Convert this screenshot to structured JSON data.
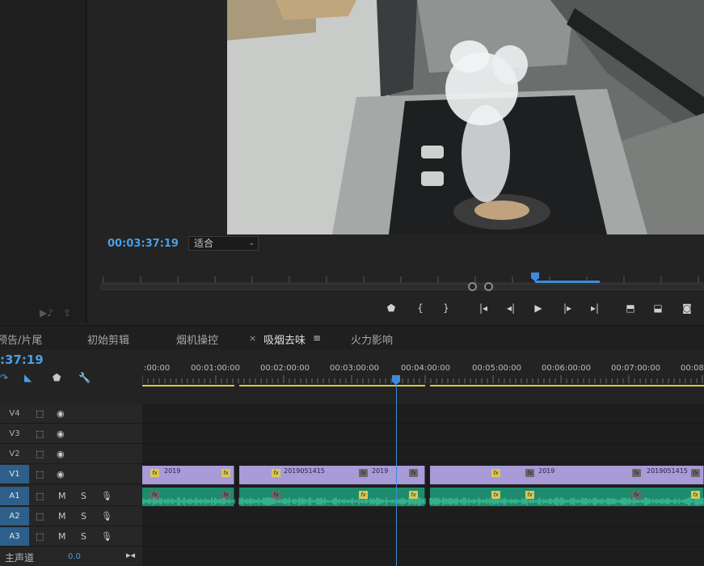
{
  "monitor": {
    "timecode": "00:03:37:19",
    "fit_label": "适合"
  },
  "tabs": [
    {
      "label": "预告/片尾"
    },
    {
      "label": "初始剪辑"
    },
    {
      "label": "烟机操控"
    },
    {
      "label": "吸烟去味",
      "active": true
    },
    {
      "label": "火力影响"
    }
  ],
  "tab_close": "×",
  "tab_menu": "≡",
  "sequence": {
    "timecode": ":37:19",
    "ruler_ticks": [
      ":00:00",
      "00:01:00:00",
      "00:02:00:00",
      "00:03:00:00",
      "00:04:00:00",
      "00:05:00:00",
      "00:06:00:00",
      "00:07:00:00",
      "00:08"
    ]
  },
  "tracks": {
    "video": [
      "V4",
      "V3",
      "V2",
      "V1"
    ],
    "audio": [
      "A1",
      "A2",
      "A3"
    ],
    "m_label": "M",
    "s_label": "S"
  },
  "clips": {
    "labels": [
      "2019",
      "2019051415",
      "2019",
      "2019",
      "2019051415"
    ]
  },
  "master": {
    "label": "主声道",
    "value": "0.0"
  },
  "colors": {
    "accent_blue": "#4a9fe6",
    "video_clip": "#a99ad8",
    "audio_clip": "#1e8b6e",
    "fx_badge": "#d9c95a"
  }
}
